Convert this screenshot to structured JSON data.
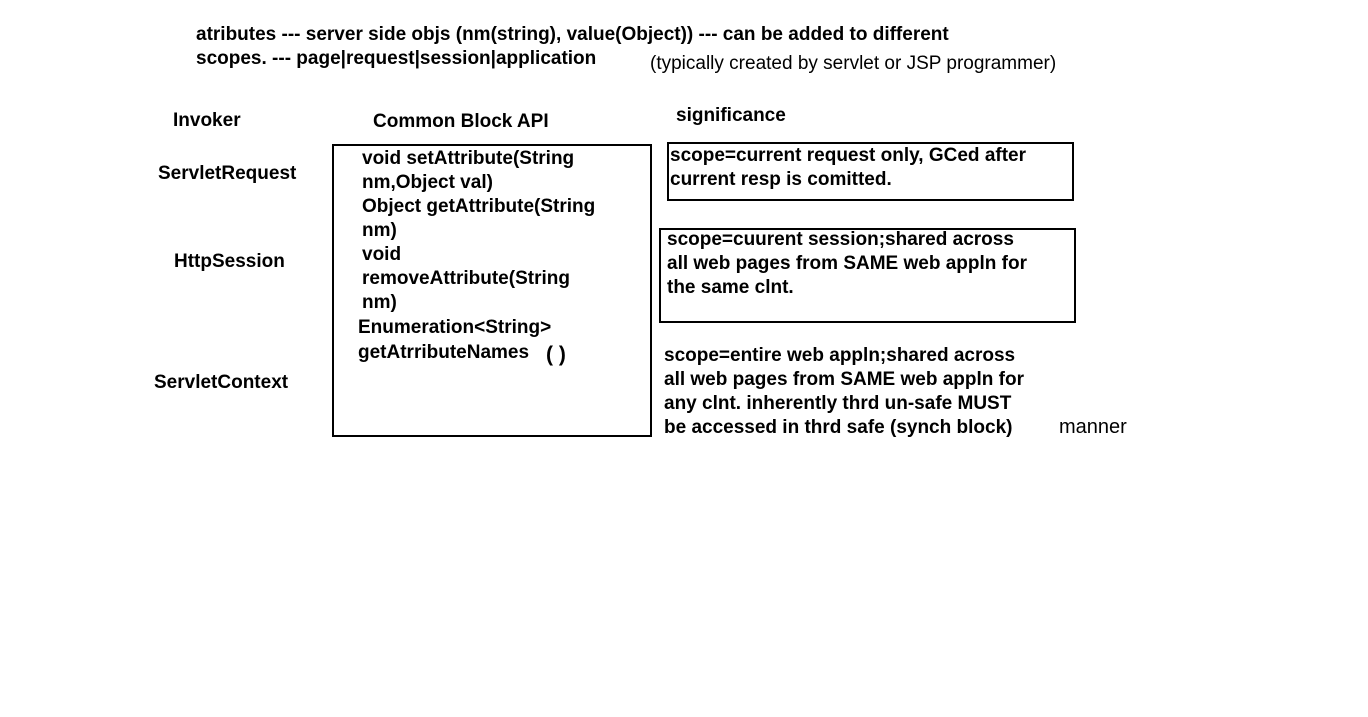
{
  "header": {
    "line1": "atributes --- server side objs (nm(string), value(Object)) --- can be added to different",
    "line2": "scopes. --- page|request|session|application",
    "note": "(typically created by servlet or JSP programmer)"
  },
  "columns": {
    "invoker": "Invoker",
    "api": "Common Block API",
    "significance": "significance"
  },
  "invokers": {
    "request": "ServletRequest",
    "session": "HttpSession",
    "context": "ServletContext"
  },
  "api_lines": [
    "void setAttribute(String",
    "nm,Object val)",
    "Object getAttribute(String",
    "nm)",
    "void",
    "removeAttribute(String",
    "nm)",
    "Enumeration<String>",
    "getAtrributeNames",
    "( )"
  ],
  "significance": {
    "request": [
      "scope=current request only, GCed after",
      "current resp is comitted."
    ],
    "session": [
      "scope=cuurent session;shared across",
      "all web pages from SAME web appln for",
      "the same clnt."
    ],
    "context": [
      "scope=entire web appln;shared across",
      "all web pages from SAME web appln for",
      "any clnt. inherently thrd un-safe MUST",
      "be accessed in thrd safe (synch block)",
      "manner"
    ]
  }
}
